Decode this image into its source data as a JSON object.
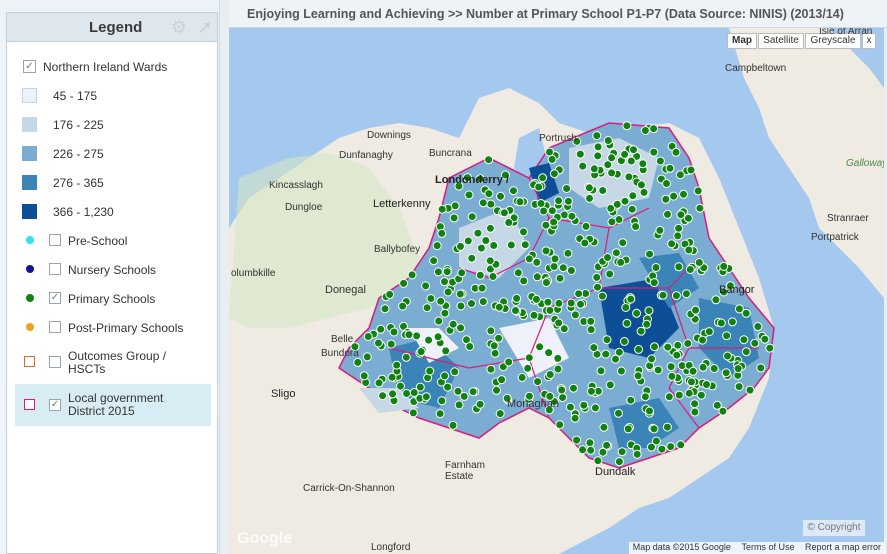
{
  "legend": {
    "title": "Legend",
    "icons": [
      "gear-icon",
      "pin-icon"
    ],
    "items": [
      {
        "label": "Northern Ireland Wards",
        "checked": true
      },
      {
        "label": "45 - 175",
        "color": "#eef1f9"
      },
      {
        "label": "176 - 225",
        "color": "#c6d7e6"
      },
      {
        "label": "226 - 275",
        "color": "#7bacd1"
      },
      {
        "label": "276 - 365",
        "color": "#3b84b8"
      },
      {
        "label": "366 - 1,230",
        "color": "#0d4f96"
      },
      {
        "label": "Pre-School",
        "color": "#35e0f5",
        "checked": false
      },
      {
        "label": "Nursery Schools",
        "color": "#121296",
        "checked": false
      },
      {
        "label": "Primary Schools",
        "color": "#118211",
        "checked": true
      },
      {
        "label": "Post-Primary Schools",
        "color": "#f0a01e",
        "checked": false
      },
      {
        "label": "Outcomes Group / HSCTs",
        "color": "#e06b25",
        "checked": false
      },
      {
        "label": "Local government District 2015",
        "color": "#d81c7c",
        "checked": true
      }
    ]
  },
  "map": {
    "title": "Enjoying Learning and Achieving >>  Number at Primary School P1-P7 (Data Source: NINIS) (2013/14)",
    "map_types": [
      "Map",
      "Satellite",
      "Greyscale",
      "x"
    ],
    "selected_map_type": "Map",
    "places": [
      "Campbeltown",
      "Isle of Arran",
      "Portrush",
      "Downings",
      "Buncrana",
      "Londonderry /",
      "Dunfanaghy",
      "Kincasslagh",
      "Dungloe",
      "Letterkenny",
      "Ballybofey",
      "Donegal",
      "olumbkille",
      "Belle",
      "Bundora",
      "Sligo",
      "Monaghan",
      "Bangor",
      "Stranraer",
      "Portpatrick",
      "Galloway",
      "Farnham Estate",
      "Dundalk",
      "Carrick-On-Shannon",
      "Longford"
    ],
    "copyright": "Copyright",
    "footer": [
      "Map data ©2015 Google",
      "Terms of Use",
      "Report a map error"
    ],
    "logo": "Google"
  }
}
